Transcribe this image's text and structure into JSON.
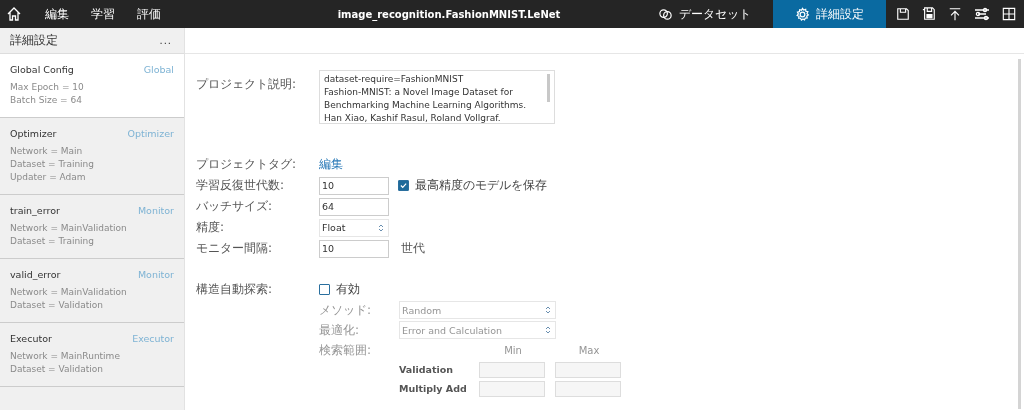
{
  "topbar": {
    "menu": [
      {
        "label": "編集"
      },
      {
        "label": "学習"
      },
      {
        "label": "評価"
      }
    ],
    "title": "image_recognition.FashionMNIST.LeNet",
    "tabs": [
      {
        "label": "データセット",
        "kind": "link",
        "selected": false
      },
      {
        "label": "詳細設定",
        "kind": "gear",
        "selected": true
      }
    ]
  },
  "sidebar": {
    "title": "詳細設定",
    "more": "...",
    "items": [
      {
        "name": "Global Config",
        "type": "Global",
        "lines": [
          "Max Epoch = 10",
          "Batch Size = 64"
        ],
        "selected": true
      },
      {
        "name": "Optimizer",
        "type": "Optimizer",
        "lines": [
          "Network = Main",
          "Dataset = Training",
          "Updater = Adam"
        ],
        "selected": false
      },
      {
        "name": "train_error",
        "type": "Monitor",
        "lines": [
          "Network = MainValidation",
          "Dataset = Training"
        ],
        "selected": false
      },
      {
        "name": "valid_error",
        "type": "Monitor",
        "lines": [
          "Network = MainValidation",
          "Dataset = Validation"
        ],
        "selected": false
      },
      {
        "name": "Executor",
        "type": "Executor",
        "lines": [
          "Network = MainRuntime",
          "Dataset = Validation"
        ],
        "selected": false
      }
    ]
  },
  "form": {
    "description": {
      "label": "プロジェクト説明:",
      "value": "dataset-require=FashionMNIST\nFashion-MNIST: a Novel Image Dataset for\nBenchmarking Machine Learning Algorithms.\nHan Xiao, Kashif Rasul, Roland Vollgraf."
    },
    "tag": {
      "label": "プロジェクトタグ:",
      "link": "編集"
    },
    "epochs": {
      "label": "学習反復世代数:",
      "value": "10",
      "checkbox": {
        "label": "最高精度のモデルを保存",
        "checked": true
      }
    },
    "batch": {
      "label": "バッチサイズ:",
      "value": "64"
    },
    "precision": {
      "label": "精度:",
      "value": "Float"
    },
    "monitor": {
      "label": "モニター間隔:",
      "value": "10",
      "unit": "世代"
    },
    "search": {
      "label": "構造自動探索:",
      "checkbox": {
        "label": "有効",
        "checked": false
      },
      "method": {
        "label": "メソッド:",
        "value": "Random"
      },
      "optimization": {
        "label": "最適化:",
        "value": "Error and Calculation"
      },
      "range": {
        "label": "検索範囲:",
        "columns": [
          "Min",
          "Max"
        ],
        "rows": [
          {
            "label": "Validation"
          },
          {
            "label": "Multiply Add"
          }
        ]
      }
    }
  }
}
